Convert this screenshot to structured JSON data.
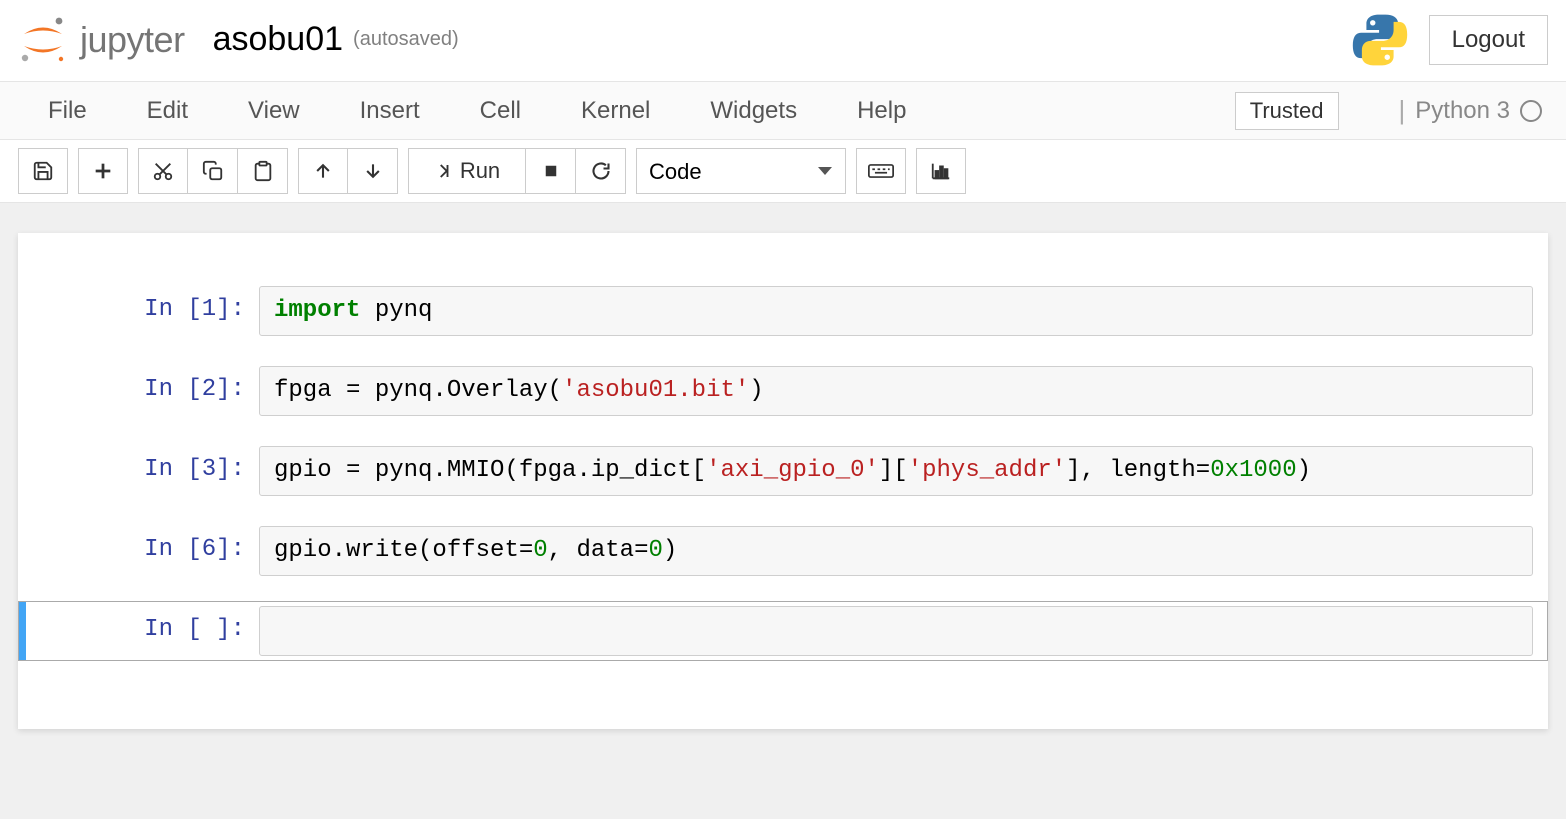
{
  "header": {
    "logo_text": "jupyter",
    "notebook_name": "asobu01",
    "autosave": "(autosaved)",
    "logout": "Logout"
  },
  "menubar": {
    "items": [
      "File",
      "Edit",
      "View",
      "Insert",
      "Cell",
      "Kernel",
      "Widgets",
      "Help"
    ],
    "trusted": "Trusted",
    "kernel_name": "Python 3"
  },
  "toolbar": {
    "run_label": "Run",
    "celltype": "Code"
  },
  "cells": [
    {
      "prompt": "In [1]:",
      "selected": false,
      "tokens": [
        {
          "t": "import",
          "c": "kw"
        },
        {
          "t": " pynq",
          "c": "plain"
        }
      ]
    },
    {
      "prompt": "In [2]:",
      "selected": false,
      "tokens": [
        {
          "t": "fpga = pynq.Overlay(",
          "c": "plain"
        },
        {
          "t": "'asobu01.bit'",
          "c": "str"
        },
        {
          "t": ")",
          "c": "plain"
        }
      ]
    },
    {
      "prompt": "In [3]:",
      "selected": false,
      "tokens": [
        {
          "t": "gpio = pynq.MMIO(fpga.ip_dict[",
          "c": "plain"
        },
        {
          "t": "'axi_gpio_0'",
          "c": "str"
        },
        {
          "t": "][",
          "c": "plain"
        },
        {
          "t": "'phys_addr'",
          "c": "str"
        },
        {
          "t": "], length=",
          "c": "plain"
        },
        {
          "t": "0x1000",
          "c": "num"
        },
        {
          "t": ")",
          "c": "plain"
        }
      ]
    },
    {
      "prompt": "In [6]:",
      "selected": false,
      "tokens": [
        {
          "t": "gpio.write(offset=",
          "c": "plain"
        },
        {
          "t": "0",
          "c": "num"
        },
        {
          "t": ", data=",
          "c": "plain"
        },
        {
          "t": "0",
          "c": "num"
        },
        {
          "t": ")",
          "c": "plain"
        }
      ]
    },
    {
      "prompt": "In [ ]:",
      "selected": true,
      "tokens": []
    }
  ]
}
